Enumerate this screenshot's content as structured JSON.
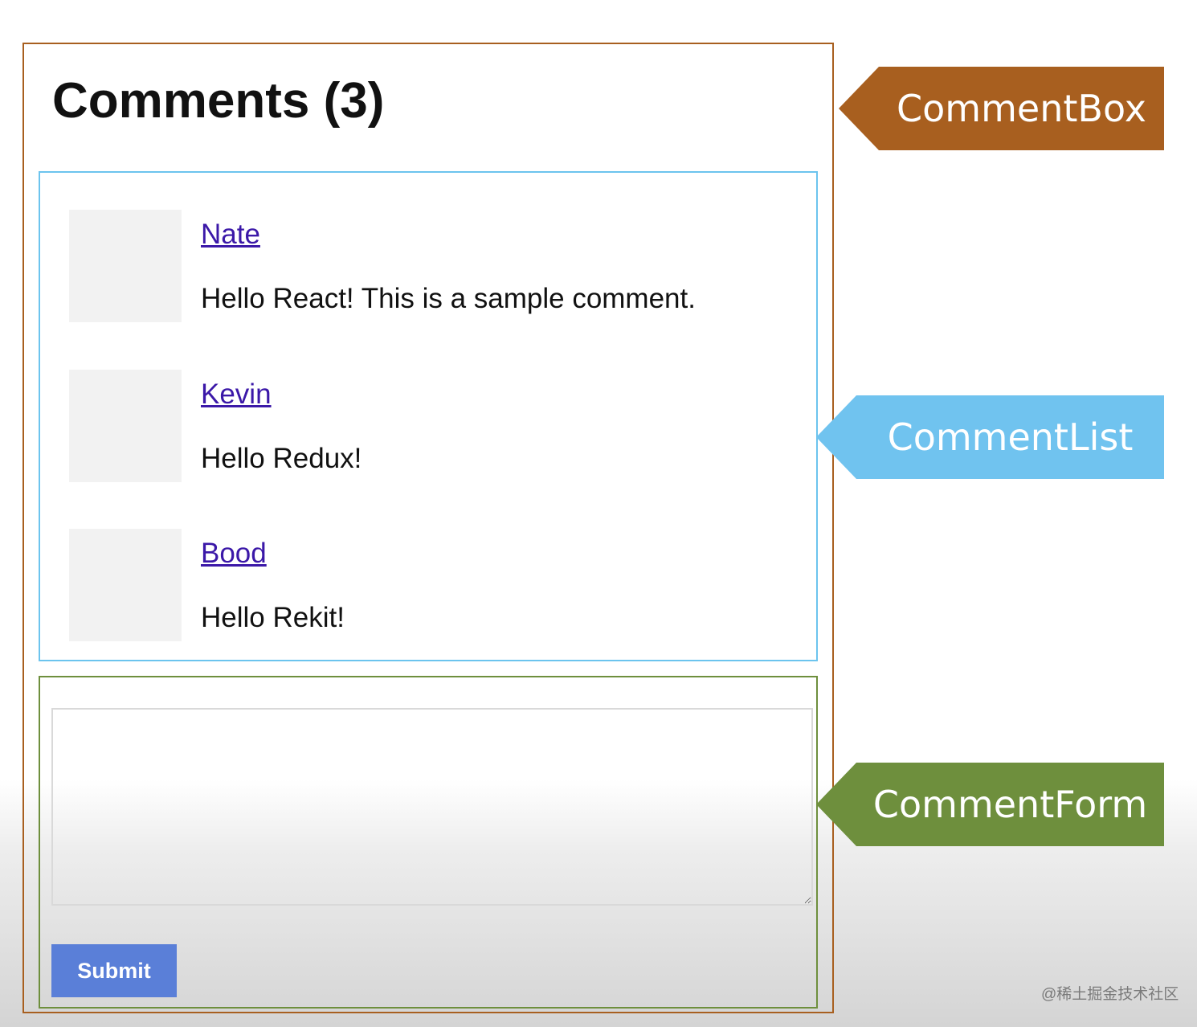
{
  "comment_box": {
    "title": "Comments (3)",
    "comments": [
      {
        "author": "Nate",
        "text": "Hello React! This is a sample comment."
      },
      {
        "author": "Kevin",
        "text": "Hello Redux!"
      },
      {
        "author": "Bood",
        "text": "Hello Rekit!"
      }
    ],
    "form": {
      "textarea_value": "",
      "submit_label": "Submit"
    }
  },
  "annotations": {
    "comment_box_label": "CommentBox",
    "comment_list_label": "CommentList",
    "comment_form_label": "CommentForm"
  },
  "watermark": "@稀土掘金技术社区",
  "colors": {
    "comment_box_border": "#a85f1f",
    "comment_list_border": "#6cc4ee",
    "comment_form_border": "#6e8f3d",
    "link": "#3b18a8",
    "submit_button": "#5a7fd8"
  }
}
